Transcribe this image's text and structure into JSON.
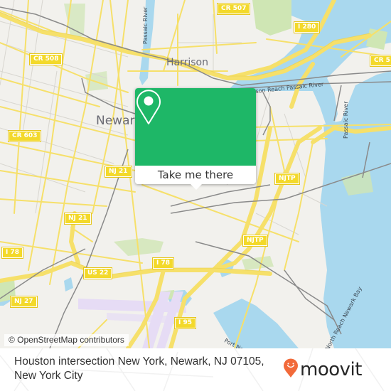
{
  "map": {
    "place_labels": {
      "newark": "Newark",
      "harrison": "Harrison"
    },
    "water_labels": {
      "passaic_river_north": "Passaic River",
      "harrison_reach": "Harrison Reach Passaic River",
      "passaic_river_east": "Passaic River",
      "newark_bay": "North Reach Newark Bay",
      "port_newark": "Port Newark"
    },
    "road_shields": [
      {
        "id": "cr507",
        "label": "CR 507"
      },
      {
        "id": "cr508",
        "label": "CR 508"
      },
      {
        "id": "i280",
        "label": "I 280"
      },
      {
        "id": "cr5xx",
        "label": "CR 5"
      },
      {
        "id": "cr603",
        "label": "CR 603"
      },
      {
        "id": "nj21a",
        "label": "NJ 21"
      },
      {
        "id": "nj21b",
        "label": "NJ 21"
      },
      {
        "id": "njtp1",
        "label": "NJTP"
      },
      {
        "id": "njtp2",
        "label": "NJTP"
      },
      {
        "id": "i78a",
        "label": "I 78"
      },
      {
        "id": "i78b",
        "label": "I 78"
      },
      {
        "id": "us22",
        "label": "US 22"
      },
      {
        "id": "nj27",
        "label": "NJ 27"
      },
      {
        "id": "i95",
        "label": "I 95"
      }
    ],
    "colors": {
      "land": "#f2f1ed",
      "water": "#a9d8ee",
      "park": "#cfe6b4",
      "road": "#f6e06a",
      "rail": "#8a8a8a",
      "airport": "#e6dcf5"
    }
  },
  "popup": {
    "icon": "map-pin-icon",
    "button_label": "Take me there",
    "color": "#1eb767"
  },
  "attribution": "© OpenStreetMap contributors",
  "footer": {
    "address_line1": "Houston intersection New York, Newark, NJ 07105,",
    "address_line2": "New York City",
    "brand": "moovit",
    "brand_color": "#f26a3a"
  }
}
